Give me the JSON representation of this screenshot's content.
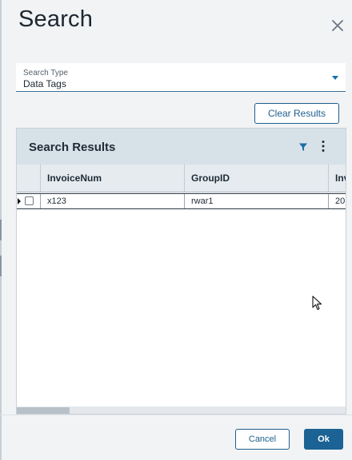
{
  "dialog": {
    "title": "Search"
  },
  "search_type": {
    "label": "Search Type",
    "value": "Data Tags"
  },
  "actions": {
    "clear_results": "Clear Results"
  },
  "results": {
    "title": "Search Results",
    "columns": [
      "InvoiceNum",
      "GroupID",
      "Inv"
    ],
    "rows": [
      {
        "InvoiceNum": "x123",
        "GroupID": "rwar1",
        "Inv": "20"
      }
    ]
  },
  "footer": {
    "cancel": "Cancel",
    "ok": "Ok"
  },
  "colors": {
    "accent": "#1b6394",
    "header_bg": "#d7e1e8",
    "filter_icon": "#1a6ea6"
  },
  "icons": [
    "close-icon",
    "chevron-down-icon",
    "filter-icon",
    "more-vertical-icon",
    "mouse-pointer-icon"
  ]
}
